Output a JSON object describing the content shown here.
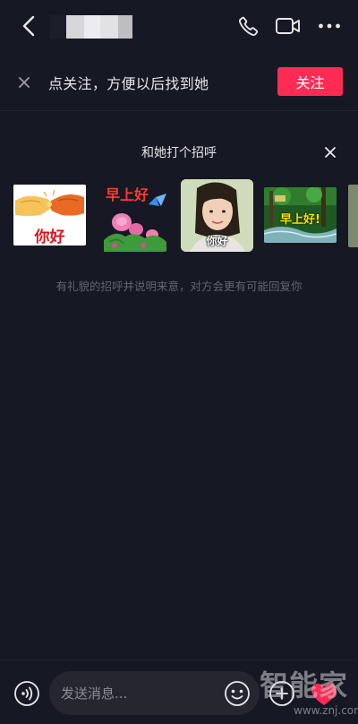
{
  "header": {
    "title": "",
    "back_icon": "chevron-left-icon",
    "phone_icon": "phone-icon",
    "video_icon": "video-camera-icon",
    "more_icon": "more-dots-icon"
  },
  "follow_bar": {
    "text": "点关注，方便以后找到她",
    "button_label": "关注",
    "button_color": "#fe2c55"
  },
  "greeting": {
    "title": "和她打个招呼",
    "stickers": [
      {
        "caption": "你好",
        "icon": "fist-bump-sticker"
      },
      {
        "caption": "早上好",
        "icon": "roses-butterfly-sticker"
      },
      {
        "caption": "你好",
        "icon": "girl-portrait-sticker"
      },
      {
        "caption": "早上好!",
        "icon": "forest-stream-sticker"
      },
      {
        "caption": "",
        "icon": "partial-sticker"
      }
    ],
    "hint": "有礼貌的招呼并说明来意，对方会更有可能回复你"
  },
  "input_bar": {
    "placeholder": "发送消息...",
    "voice_icon": "voice-icon",
    "emoji_icon": "emoji-icon",
    "plus_icon": "plus-icon",
    "heart_icon": "heart-icon"
  },
  "watermark": {
    "cn": "智能家",
    "url": "www.znj.com"
  },
  "colors": {
    "background": "#161823",
    "accent": "#fe2c55",
    "input_bg": "#25262f"
  }
}
